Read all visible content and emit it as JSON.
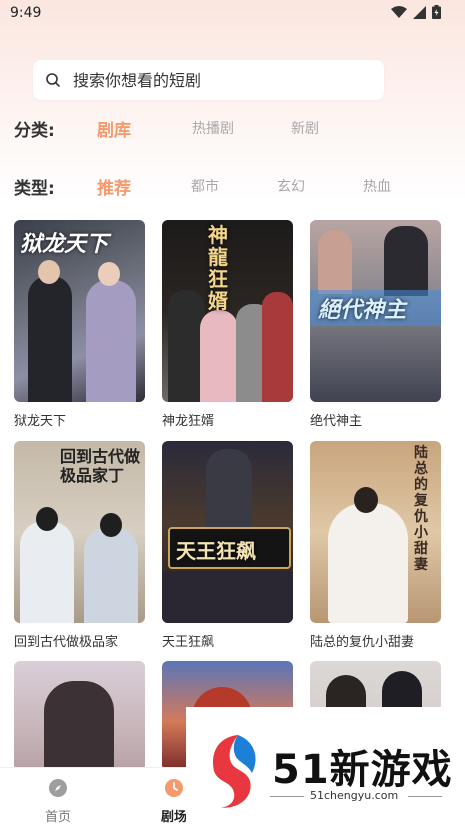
{
  "status": {
    "time": "9:49"
  },
  "search": {
    "placeholder": "搜索你想看的短剧"
  },
  "filters": {
    "category": {
      "label": "分类:",
      "options": [
        "剧库",
        "热播剧",
        "新剧"
      ],
      "active": "剧库"
    },
    "type": {
      "label": "类型:",
      "options": [
        "推荐",
        "都市",
        "玄幻",
        "热血"
      ],
      "active": "推荐"
    }
  },
  "dramas": [
    {
      "title": "狱龙天下",
      "poster_text": "狱龙天下"
    },
    {
      "title": "神龙狂婿",
      "poster_text": "神龍狂婿"
    },
    {
      "title": "绝代神主",
      "poster_text": "絕代神主"
    },
    {
      "title": "回到古代做极品家",
      "poster_text": "回到古代做极品家丁"
    },
    {
      "title": "天王狂飙",
      "poster_text": "天王狂飙"
    },
    {
      "title": "陆总的复仇小甜妻",
      "poster_text": "陆总的复仇小甜妻"
    },
    {
      "title": "",
      "poster_text": ""
    },
    {
      "title": "",
      "poster_text": ""
    },
    {
      "title": "",
      "poster_text": ""
    }
  ],
  "tabs": [
    {
      "label": "首页",
      "icon": "compass-icon",
      "active": false
    },
    {
      "label": "剧场",
      "icon": "clock-icon",
      "active": true
    }
  ],
  "watermark": {
    "title": "51新游戏",
    "url": "51chengyu.com"
  },
  "colors": {
    "accent": "#f49a6d",
    "inactive": "#a8a8a8"
  }
}
